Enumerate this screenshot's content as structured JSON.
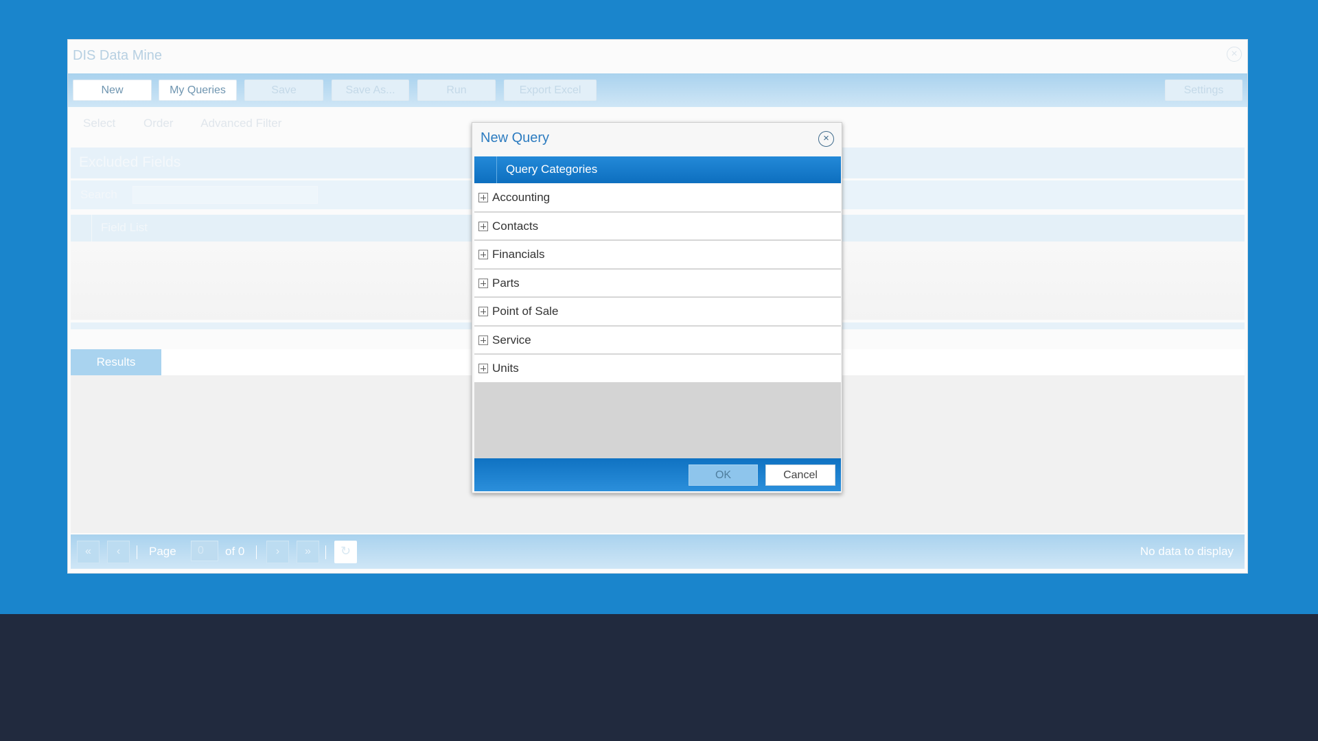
{
  "window": {
    "title": "DIS Data Mine",
    "close_icon": "×"
  },
  "toolbar": {
    "new_label": "New",
    "my_queries_label": "My Queries",
    "save_label": "Save",
    "save_as_label": "Save As...",
    "run_label": "Run",
    "export_excel_label": "Export Excel",
    "settings_label": "Settings"
  },
  "subtabs": {
    "select": "Select",
    "order": "Order",
    "advanced_filter": "Advanced Filter"
  },
  "excluded": {
    "title": "Excluded Fields",
    "search_label": "Search",
    "field_list_label": "Field List"
  },
  "results": {
    "tab_label": "Results"
  },
  "pager": {
    "page_label": "Page",
    "page_value": "0",
    "of_label": "of 0",
    "no_data": "No data to display",
    "first_icon": "«",
    "prev_icon": "‹",
    "next_icon": "›",
    "last_icon": "»",
    "refresh_icon": "↻"
  },
  "dialog": {
    "title": "New Query",
    "close_icon": "×",
    "header": "Query Categories",
    "categories": [
      {
        "label": "Accounting"
      },
      {
        "label": "Contacts"
      },
      {
        "label": "Financials"
      },
      {
        "label": "Parts"
      },
      {
        "label": "Point of Sale"
      },
      {
        "label": "Service"
      },
      {
        "label": "Units"
      }
    ],
    "ok_label": "OK",
    "cancel_label": "Cancel"
  }
}
